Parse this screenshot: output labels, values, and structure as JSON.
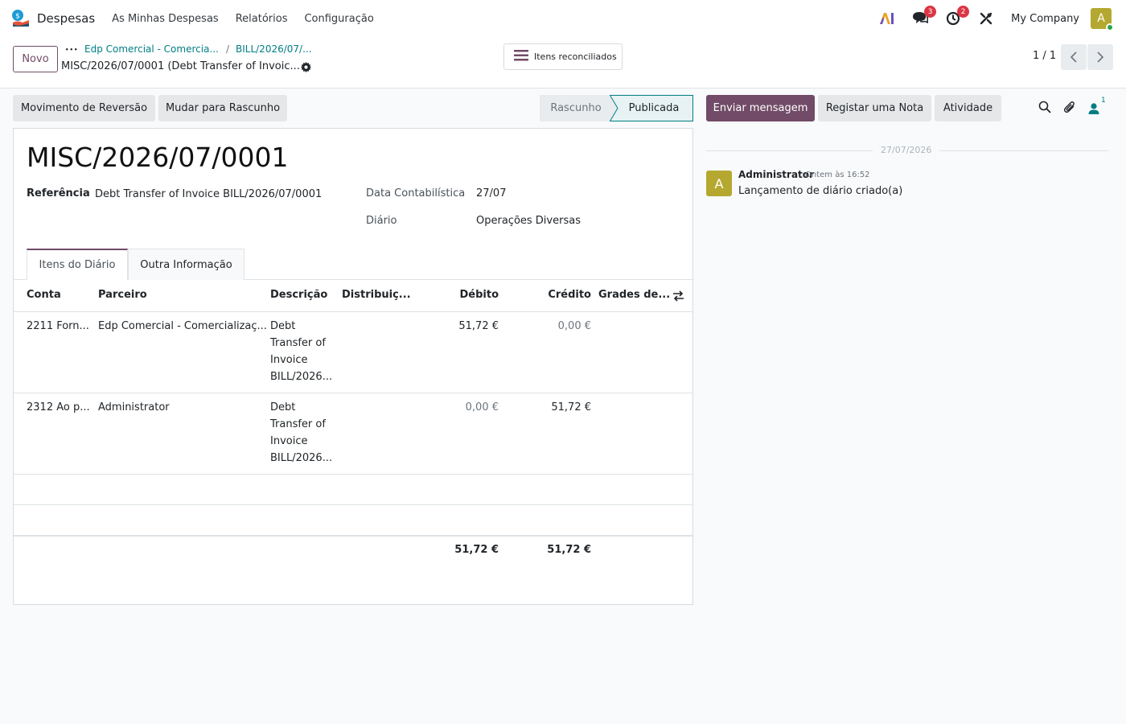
{
  "navbar": {
    "app_name": "Despesas",
    "menu": [
      "As Minhas Despesas",
      "Relatórios",
      "Configuração"
    ],
    "messages_badge": "3",
    "activities_badge": "2",
    "company": "My Company",
    "user_initial": "A"
  },
  "control_panel": {
    "new_label": "Novo",
    "breadcrumb_dots": "•••",
    "breadcrumb": [
      "Edp Comercial - Comercia...",
      "BILL/2026/07/..."
    ],
    "breadcrumb_sep": "/",
    "current_record": "MISC/2026/07/0001 (Debt Transfer of Invoic...",
    "smart_button": "Itens reconciliados",
    "pager": "1 / 1"
  },
  "status_bar": {
    "buttons": [
      "Movimento de Reversão",
      "Mudar para Rascunho"
    ],
    "stages": [
      "Rascunho",
      "Publicada"
    ],
    "active_stage": "Publicada"
  },
  "form": {
    "title": "MISC/2026/07/0001",
    "reference_label": "Referência",
    "reference_value": "Debt Transfer of Invoice BILL/2026/07/0001",
    "accounting_date_label": "Data Contabilística",
    "accounting_date_value": "27/07",
    "journal_label": "Diário",
    "journal_value": "Operações Diversas",
    "tabs": [
      "Itens do Diário",
      "Outra Informação"
    ],
    "columns": [
      "Conta",
      "Parceiro",
      "Descrição",
      "Distribuiç...",
      "Débito",
      "Crédito",
      "Grades de..."
    ],
    "lines": [
      {
        "account": "2211 Forn...",
        "partner": "Edp Comercial - Comercializaç...",
        "description": "Debt Transfer of Invoice BILL/2026...",
        "debit": "51,72 €",
        "credit": "0,00 €"
      },
      {
        "account": "2312 Ao p...",
        "partner": "Administrator",
        "description": "Debt Transfer of Invoice BILL/2026...",
        "debit": "0,00 €",
        "credit": "51,72 €"
      }
    ],
    "total_debit": "51,72 €",
    "total_credit": "51,72 €"
  },
  "chatter": {
    "send_message": "Enviar mensagem",
    "log_note": "Registar uma Nota",
    "activity": "Atividade",
    "followers_count": "1",
    "date_separator": "27/07/2026",
    "message": {
      "avatar": "A",
      "author": "Administrator",
      "time": "Ontem às 16:52",
      "body": "Lançamento de diário criado(a)"
    }
  },
  "colors": {
    "brand": "#714b67",
    "link": "#017e84",
    "badge": "#dc3545",
    "avatar": "#b5a830"
  }
}
